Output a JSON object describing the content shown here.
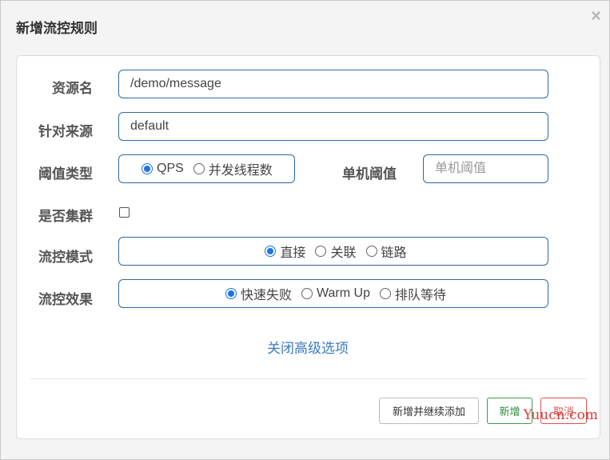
{
  "dialog": {
    "title": "新增流控规则",
    "close_label": "×"
  },
  "form": {
    "resource_name": {
      "label": "资源名",
      "value": "/demo/message"
    },
    "limit_app": {
      "label": "针对来源",
      "value": "default"
    },
    "threshold_type": {
      "label": "阈值类型",
      "options": [
        "QPS",
        "并发线程数"
      ],
      "selected": "QPS"
    },
    "single_threshold": {
      "label": "单机阈值",
      "value": "",
      "placeholder": "单机阈值"
    },
    "cluster": {
      "label": "是否集群",
      "checked": false
    },
    "strategy": {
      "label": "流控模式",
      "options": [
        "直接",
        "关联",
        "链路"
      ],
      "selected": "直接"
    },
    "control_behavior": {
      "label": "流控效果",
      "options": [
        "快速失败",
        "Warm Up",
        "排队等待"
      ],
      "selected": "快速失败"
    },
    "advanced_toggle": "关闭高级选项"
  },
  "footer": {
    "add_continue_label": "新增并继续添加",
    "add_label": "新增",
    "cancel_label": "取消"
  },
  "watermark": "Yuucn.com",
  "colors": {
    "accent": "#1a73e8",
    "field_border": "#2d6aa0",
    "success": "#3c9a4b",
    "danger": "#d9534f",
    "link": "#3a7bbf"
  }
}
